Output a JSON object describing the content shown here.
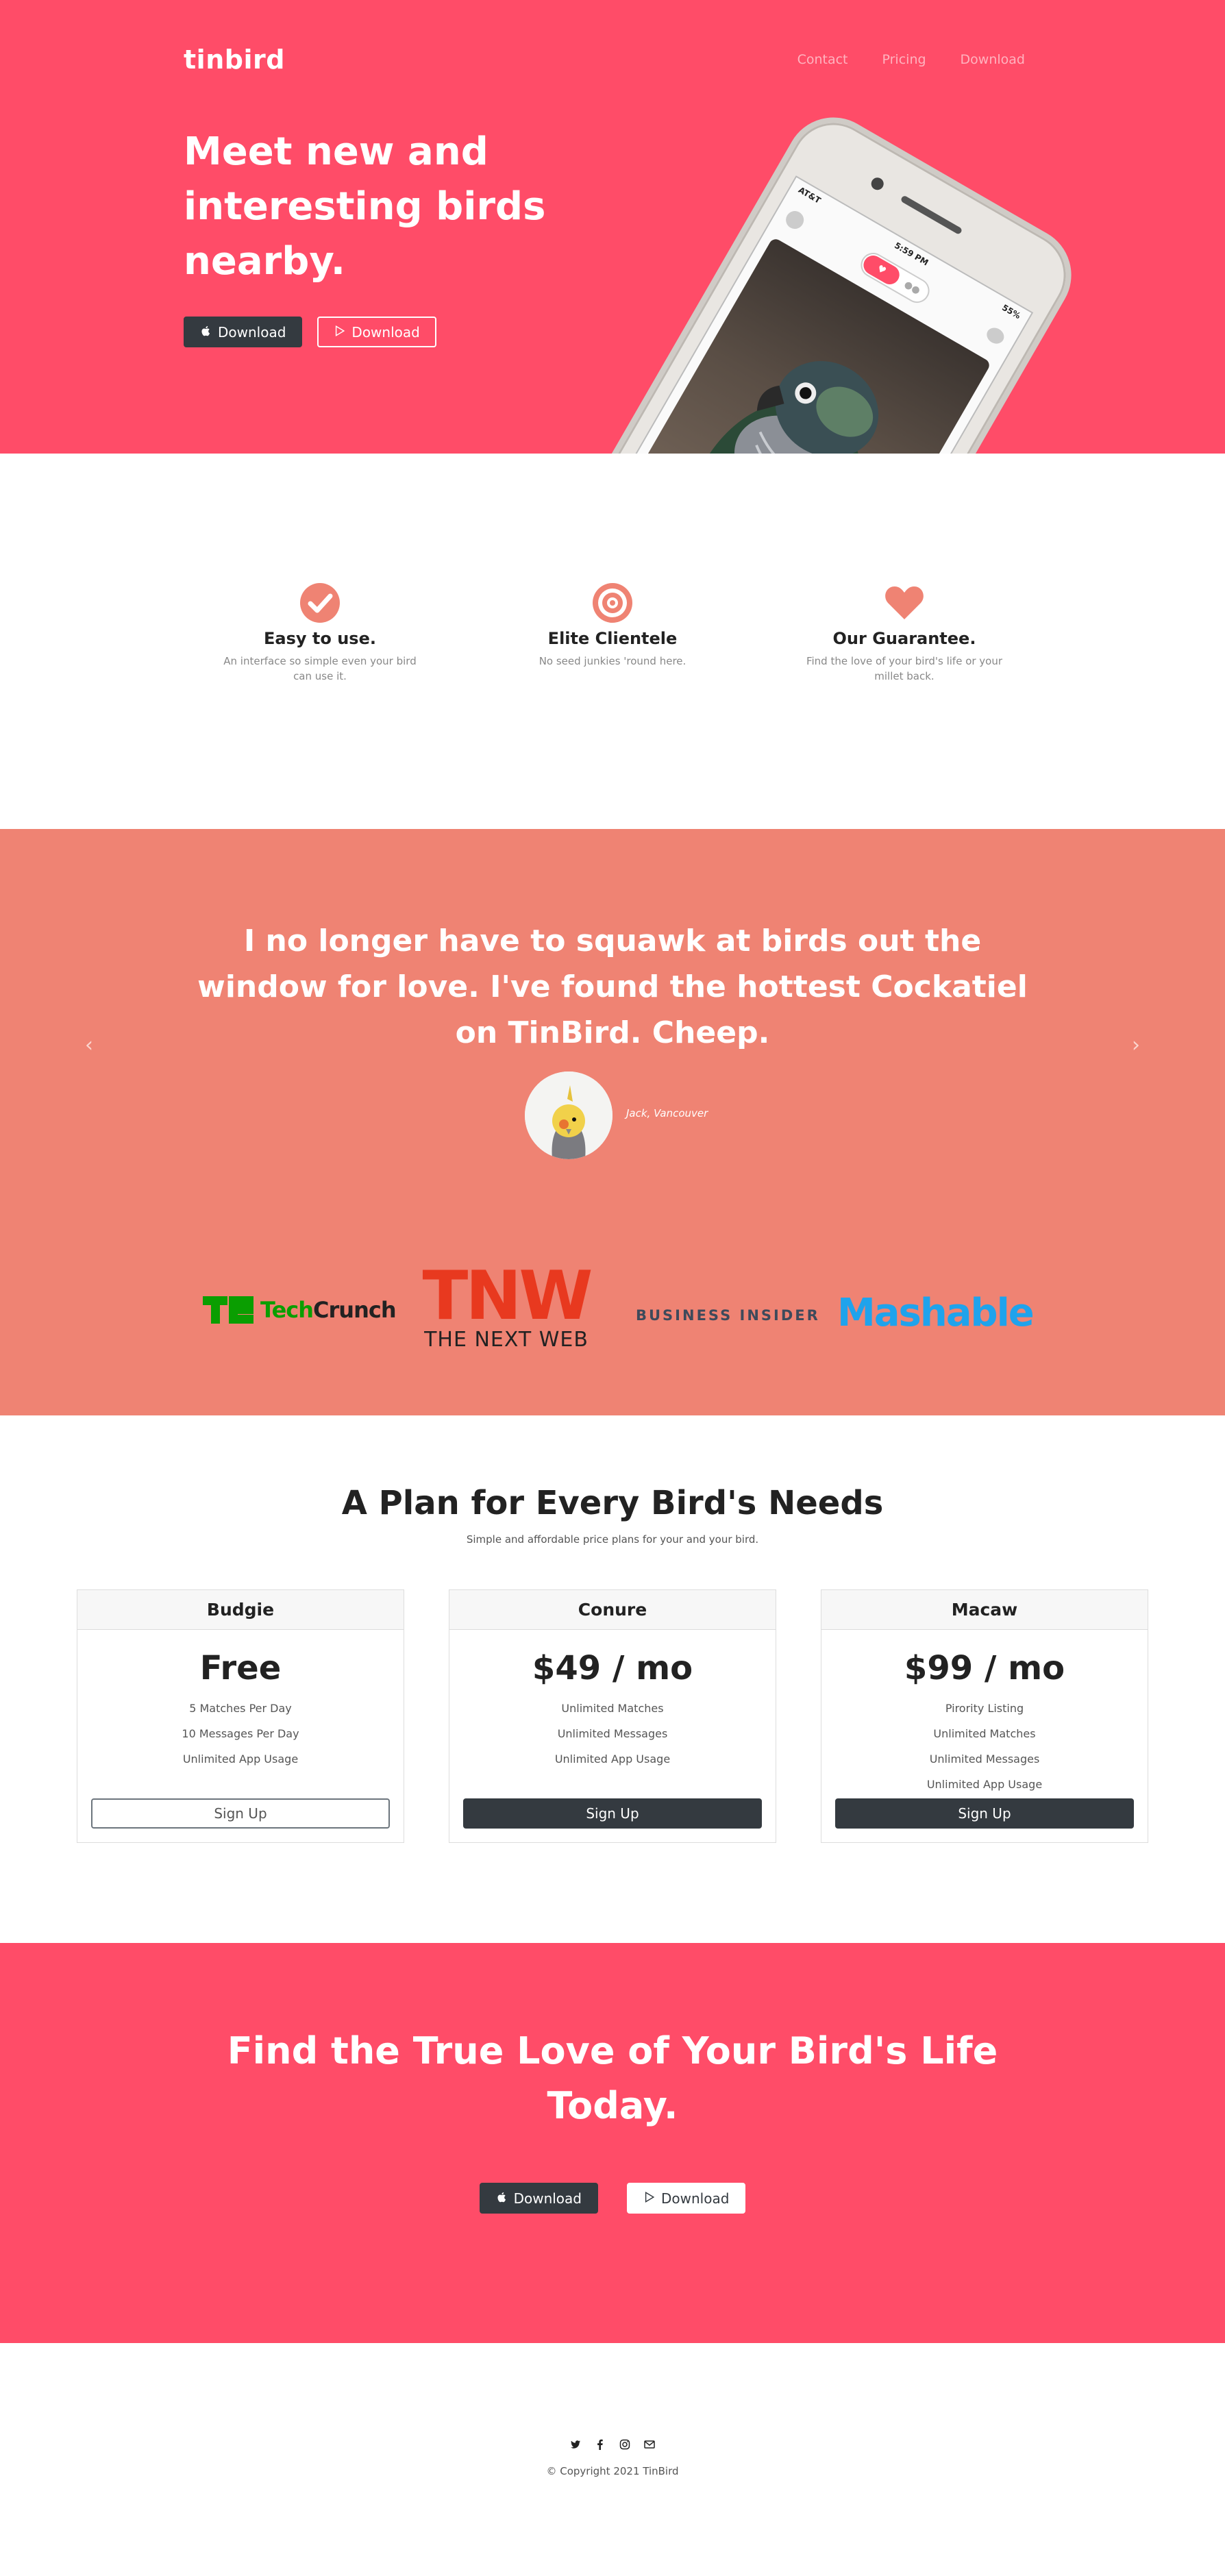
{
  "colors": {
    "brand_pink": "#ff4c68",
    "salmon": "#ef8373",
    "dark": "#343a40",
    "feature_icon": "#ef8373"
  },
  "nav": {
    "brand": "tinbird",
    "links": [
      "Contact",
      "Pricing",
      "Download"
    ]
  },
  "hero": {
    "title": "Meet new and interesting birds nearby.",
    "btn_ios": "Download",
    "btn_android": "Download",
    "phone": {
      "carrier": "AT&T",
      "time": "5:59 PM",
      "battery": "55%"
    }
  },
  "features": [
    {
      "icon": "check-circle-icon",
      "title": "Easy to use.",
      "text": "An interface so simple even your bird can use it."
    },
    {
      "icon": "bullseye-icon",
      "title": "Elite Clientele",
      "text": "No seed junkies 'round here."
    },
    {
      "icon": "heart-icon",
      "title": "Our Guarantee.",
      "text": "Find the love of your bird's life or your millet back."
    }
  ],
  "testimonial": {
    "quote": "I no longer have to squawk at birds out the window for love. I've found the hottest Cockatiel on TinBird. Cheep.",
    "author": "Jack, Vancouver",
    "prev_icon": "chevron-left-icon",
    "next_icon": "chevron-right-icon"
  },
  "press": {
    "techcrunch_a": "Tech",
    "techcrunch_b": "Crunch",
    "tnw_big": "TNW",
    "tnw_small": "THE NEXT WEB",
    "business_insider": "BUSINESS INSIDER",
    "mashable": "Mashable"
  },
  "pricing": {
    "title": "A Plan for Every Bird's Needs",
    "subtitle": "Simple and affordable price plans for your and your bird.",
    "plans": [
      {
        "name": "Budgie",
        "price": "Free",
        "features": [
          "5 Matches Per Day",
          "10 Messages Per Day",
          "Unlimited App Usage"
        ],
        "button": "Sign Up"
      },
      {
        "name": "Conure",
        "price": "$49 / mo",
        "features": [
          "Unlimited Matches",
          "Unlimited Messages",
          "Unlimited App Usage"
        ],
        "button": "Sign Up"
      },
      {
        "name": "Macaw",
        "price": "$99 / mo",
        "features": [
          "Pirority Listing",
          "Unlimited Matches",
          "Unlimited Messages",
          "Unlimited App Usage"
        ],
        "button": "Sign Up"
      }
    ]
  },
  "cta": {
    "title": "Find the True Love of Your Bird's Life Today.",
    "btn_ios": "Download",
    "btn_android": "Download"
  },
  "footer": {
    "social_icons": [
      "twitter-icon",
      "facebook-icon",
      "instagram-icon",
      "envelope-icon"
    ],
    "copyright": "© Copyright 2021 TinBird"
  }
}
